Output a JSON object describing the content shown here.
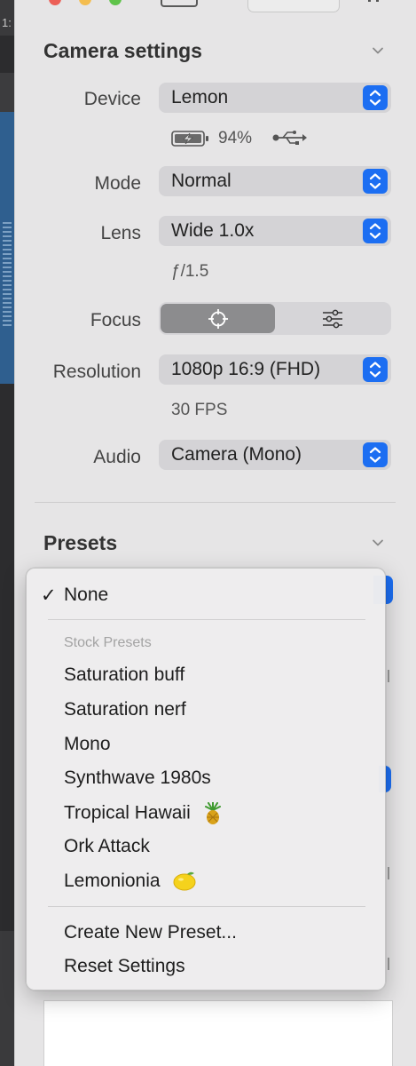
{
  "left_strip": {
    "label": "1:"
  },
  "camera": {
    "title": "Camera settings",
    "device": {
      "label": "Device",
      "value": "Lemon"
    },
    "battery": {
      "percent": "94%"
    },
    "mode": {
      "label": "Mode",
      "value": "Normal"
    },
    "lens": {
      "label": "Lens",
      "value": "Wide 1.0x"
    },
    "aperture": "ƒ/1.5",
    "focus": {
      "label": "Focus",
      "selected": "auto"
    },
    "resolution": {
      "label": "Resolution",
      "value": "1080p 16:9 (FHD)"
    },
    "fps": "30 FPS",
    "audio": {
      "label": "Audio",
      "value": "Camera (Mono)"
    }
  },
  "presets": {
    "title": "Presets"
  },
  "menu": {
    "check": "✓",
    "none": "None",
    "stock_header": "Stock Presets",
    "stock_items": [
      "Saturation buff",
      "Saturation nerf",
      "Mono",
      "Synthwave 1980s",
      "Tropical Hawaii",
      "Ork Attack",
      "Lemonionia"
    ],
    "create": "Create New Preset...",
    "reset": "Reset Settings"
  },
  "colors": {
    "accent": "#1c6ef2",
    "panel_bg": "#e6e5e6",
    "popup_bg": "#d4d3d6"
  }
}
